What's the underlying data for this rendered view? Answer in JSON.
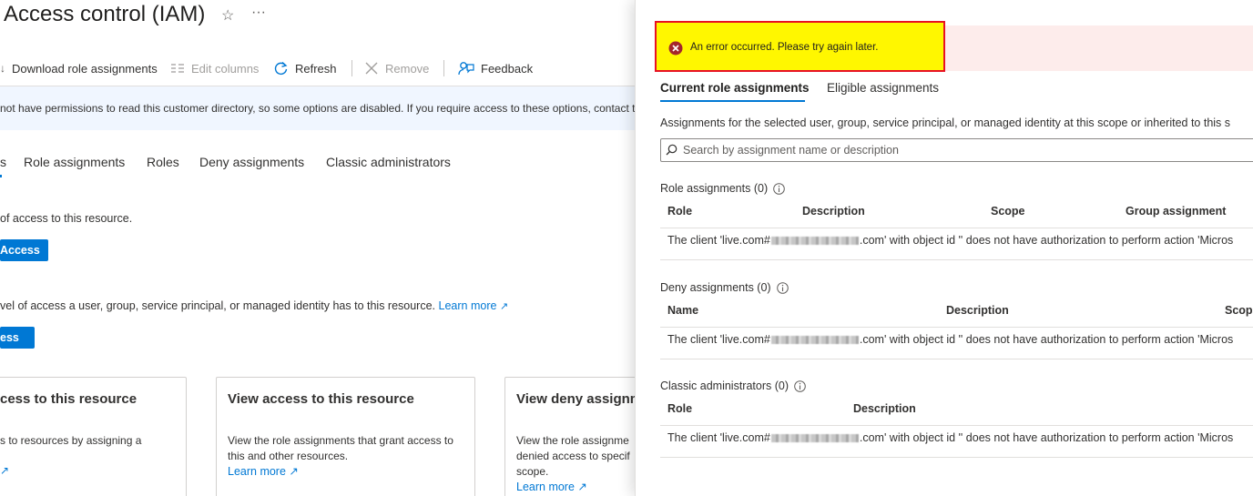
{
  "page": {
    "title": "Access control (IAM)",
    "star_icon": "star-icon",
    "more_icon": "more-icon"
  },
  "toolbar": {
    "download_label": "Download role assignments",
    "edit_columns_label": "Edit columns",
    "refresh_label": "Refresh",
    "remove_label": "Remove",
    "feedback_label": "Feedback"
  },
  "info_banner": {
    "text": "not have permissions to read this customer directory, so some options are disabled. If you require access to these options, contact th"
  },
  "tabs": [
    {
      "label": "s"
    },
    {
      "label": "Role assignments"
    },
    {
      "label": "Roles"
    },
    {
      "label": "Deny assignments"
    },
    {
      "label": "Classic administrators"
    }
  ],
  "grant_section": {
    "text": "of access to this resource.",
    "button_label": "Access"
  },
  "check_section": {
    "text": "vel of access a user, group, service principal, or managed identity has to this resource.",
    "learn_more": "Learn more",
    "button_label": "ess"
  },
  "cards": [
    {
      "title": "cess to this resource",
      "text": "s to resources by assigning a",
      "learn_more": ""
    },
    {
      "title": "View access to this resource",
      "text": "View the role assignments that grant access to this and other resources.",
      "learn_more": "Learn more"
    },
    {
      "title": "View deny assignm",
      "text": "View the role assignme denied access to specif scope.",
      "learn_more": "Learn more"
    }
  ],
  "panel": {
    "error_text": "An error occurred. Please try again later.",
    "error_color": "#e81123",
    "highlight_color": "#fff700",
    "tabs": [
      {
        "label": "Current role assignments",
        "active": true
      },
      {
        "label": "Eligible assignments",
        "active": false
      }
    ],
    "description": "Assignments for the selected user, group, service principal, or managed identity at this scope or inherited to this s",
    "search_placeholder": "Search by assignment name or description",
    "role_assignments": {
      "title": "Role assignments (0)",
      "columns": [
        "Role",
        "Description",
        "Scope",
        "Group assignment"
      ],
      "row": {
        "prefix": "The client 'live.com#",
        "suffix": ".com' with object id '' does not have authorization to perform action 'Micros"
      }
    },
    "deny_assignments": {
      "title": "Deny assignments (0)",
      "columns": [
        "Name",
        "Description",
        "Scope"
      ],
      "row": {
        "prefix": "The client 'live.com#",
        "suffix": ".com' with object id '' does not have authorization to perform action 'Micros"
      }
    },
    "classic_admins": {
      "title": "Classic administrators (0)",
      "columns": [
        "Role",
        "Description"
      ],
      "row": {
        "prefix": "The client 'live.com#",
        "suffix": ".com' with object id '' does not have authorization to perform action 'Micros"
      }
    }
  }
}
